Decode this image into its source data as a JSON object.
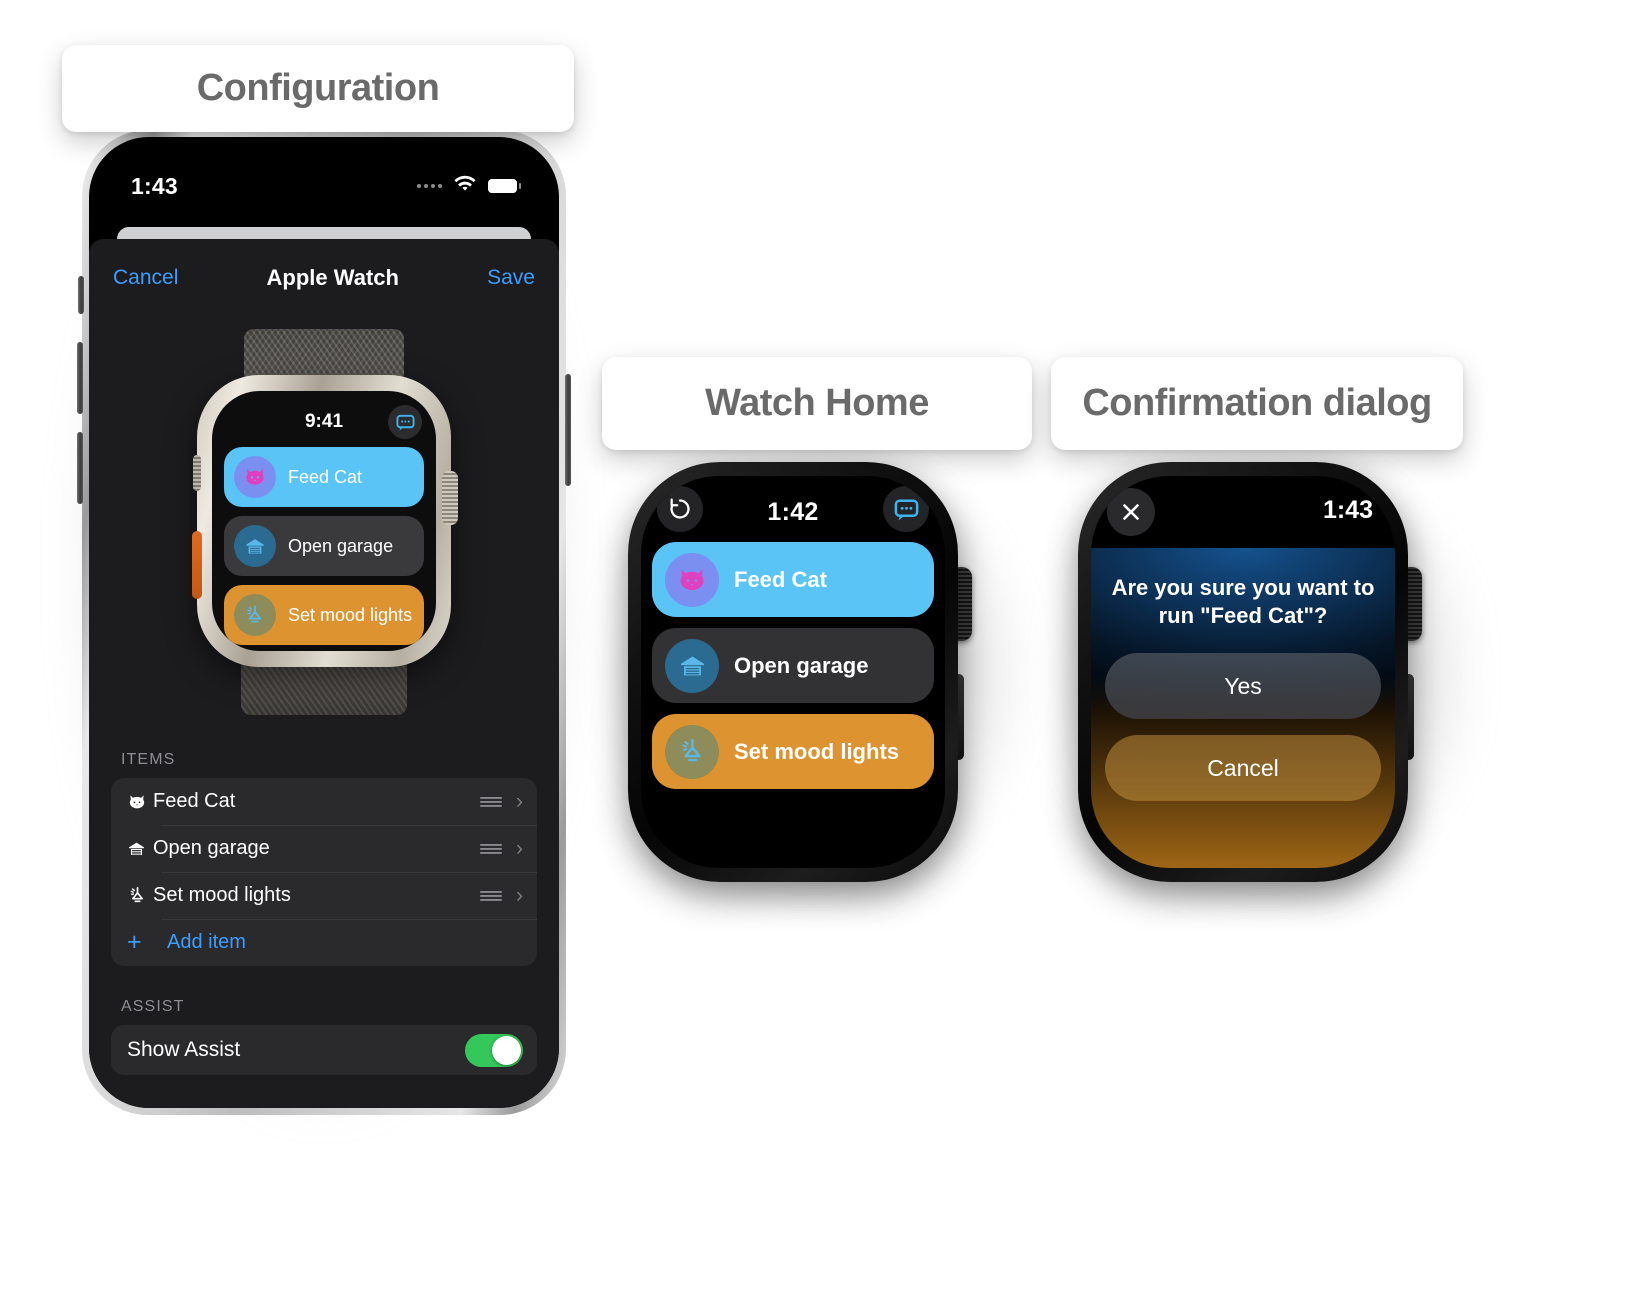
{
  "captions": {
    "configuration": "Configuration",
    "watch_home": "Watch Home",
    "confirmation_dialog": "Confirmation dialog"
  },
  "phone": {
    "status_bar": {
      "time": "1:43",
      "wifi_icon": "wifi-icon",
      "battery_icon": "battery-full-icon",
      "signal_icon": "signal-dots-icon"
    },
    "nav": {
      "cancel": "Cancel",
      "title": "Apple Watch",
      "save": "Save"
    },
    "watch_preview": {
      "time": "9:41",
      "message_icon": "message-bubble-icon",
      "rows": [
        {
          "label": "Feed Cat",
          "icon": "cat-icon"
        },
        {
          "label": "Open garage",
          "icon": "garage-icon"
        },
        {
          "label": "Set mood lights",
          "icon": "pendant-lamp-icon"
        }
      ]
    },
    "items_section": {
      "header": "ITEMS",
      "rows": [
        {
          "label": "Feed Cat",
          "icon": "cat-icon"
        },
        {
          "label": "Open garage",
          "icon": "garage-icon"
        },
        {
          "label": "Set mood lights",
          "icon": "pendant-lamp-icon"
        }
      ],
      "add_item": "Add item",
      "add_icon": "plus-icon",
      "drag_icon": "drag-handle-icon",
      "chevron_icon": "chevron-right-icon"
    },
    "assist_section": {
      "header": "ASSIST",
      "toggle_label": "Show Assist",
      "toggle_on": true
    }
  },
  "watch_home": {
    "time": "1:42",
    "refresh_icon": "refresh-icon",
    "message_icon": "message-bubble-icon",
    "rows": [
      {
        "label": "Feed Cat",
        "icon": "cat-icon"
      },
      {
        "label": "Open garage",
        "icon": "garage-icon"
      },
      {
        "label": "Set mood lights",
        "icon": "pendant-lamp-icon"
      }
    ]
  },
  "watch_dialog": {
    "time": "1:43",
    "close_icon": "close-x-icon",
    "question": "Are you sure you want to run \"Feed Cat\"?",
    "yes": "Yes",
    "cancel": "Cancel"
  },
  "colors": {
    "accent_blue": "#3b9dff",
    "row_blue": "#59c4f5",
    "row_gray": "#323234",
    "row_orange": "#dd9430",
    "toggle_green": "#34c759",
    "caption_text": "#6a6a6a",
    "cat_icon_pink": "#e040c0",
    "garage_icon_blue": "#5ab7e8",
    "lamp_icon_blue": "#5ab7e8"
  }
}
